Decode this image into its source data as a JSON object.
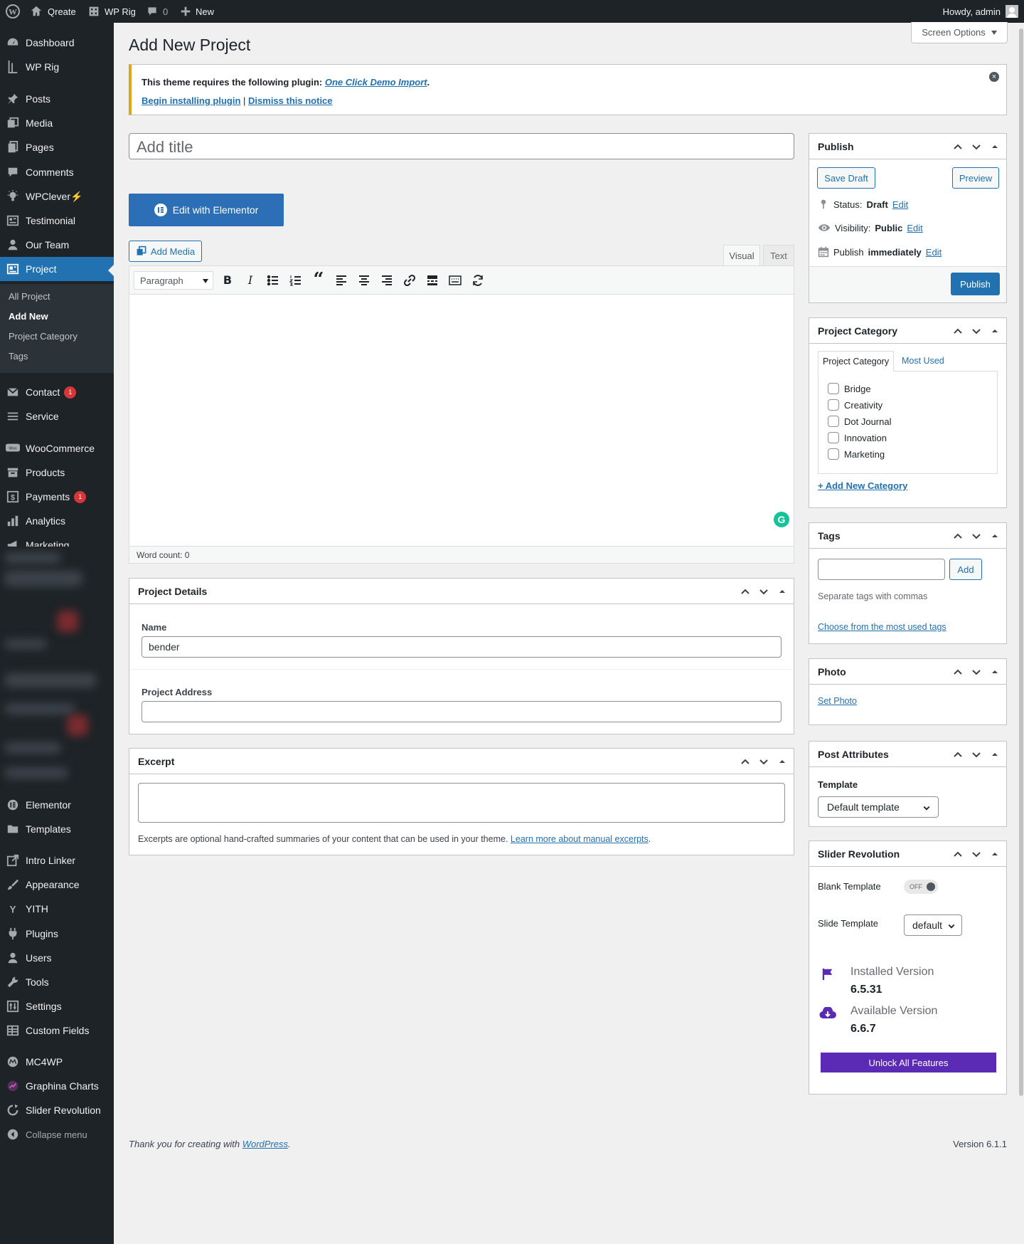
{
  "adminbar": {
    "site_name": "Qreate",
    "theme": "WP Rig",
    "comments": "0",
    "new": "New",
    "howdy": "Howdy, admin"
  },
  "sidebar": {
    "items": [
      "Dashboard",
      "WP Rig",
      "Posts",
      "Media",
      "Pages",
      "Comments",
      "WPClever⚡",
      "Testimonial",
      "Our Team",
      "Project",
      "Contact",
      "Service",
      "WooCommerce",
      "Products",
      "Payments",
      "Analytics",
      "Marketing",
      "Elementor",
      "Templates",
      "Intro Linker",
      "Appearance",
      "YITH",
      "Plugins",
      "Users",
      "Tools",
      "Settings",
      "Custom Fields",
      "MC4WP",
      "Graphina Charts",
      "Slider Revolution",
      "Collapse menu"
    ],
    "contact_badge": "1",
    "payments_badge": "1",
    "submenu": [
      "All Project",
      "Add New",
      "Project Category",
      "Tags"
    ]
  },
  "page": {
    "title": "Add New Project",
    "screen_options": "Screen Options"
  },
  "notice": {
    "text": "This theme requires the following plugin:",
    "plugin": "One Click Demo Import",
    "begin": "Begin installing plugin",
    "sep": "|",
    "dismiss": "Dismiss this notice"
  },
  "editor": {
    "title_placeholder": "Add title",
    "elementor_button": "Edit with Elementor",
    "add_media": "Add Media",
    "tab_visual": "Visual",
    "tab_text": "Text",
    "format": "Paragraph",
    "word_count": "Word count: 0"
  },
  "project_details": {
    "title": "Project Details",
    "name_label": "Name",
    "name_value": "bender",
    "address_label": "Project Address",
    "address_value": ""
  },
  "excerpt": {
    "title": "Excerpt",
    "help": "Excerpts are optional hand-crafted summaries of your content that can be used in your theme.",
    "link": "Learn more about manual excerpts",
    "period": "."
  },
  "publish": {
    "title": "Publish",
    "save_draft": "Save Draft",
    "preview": "Preview",
    "status_label": "Status:",
    "status_value": "Draft",
    "visibility_label": "Visibility:",
    "visibility_value": "Public",
    "publish_label": "Publish",
    "publish_value": "immediately",
    "edit": "Edit",
    "publish_button": "Publish"
  },
  "category": {
    "title": "Project Category",
    "tab_all": "Project Category",
    "tab_used": "Most Used",
    "items": [
      "Bridge",
      "Creativity",
      "Dot Journal",
      "Innovation",
      "Marketing"
    ],
    "add_new": "+ Add New Category"
  },
  "tags": {
    "title": "Tags",
    "add": "Add",
    "help": "Separate tags with commas",
    "choose": "Choose from the most used tags"
  },
  "photo": {
    "title": "Photo",
    "set": "Set Photo"
  },
  "attributes": {
    "title": "Post Attributes",
    "template_label": "Template",
    "template_value": "Default template"
  },
  "slider": {
    "title": "Slider Revolution",
    "blank_label": "Blank Template",
    "toggle": "OFF",
    "slide_label": "Slide Template",
    "slide_value": "default",
    "installed_label": "Installed Version",
    "installed_value": "6.5.31",
    "available_label": "Available Version",
    "available_value": "6.6.7",
    "unlock": "Unlock All Features"
  },
  "footer": {
    "thanks": "Thank you for creating with",
    "wp": "WordPress",
    "period": ".",
    "version": "Version 6.1.1"
  },
  "colors": {
    "primary": "#2271b1",
    "sidebar": "#1d2327",
    "badge": "#d63638",
    "purple": "#5b2bb5",
    "elementor": "#2c6fb6"
  }
}
